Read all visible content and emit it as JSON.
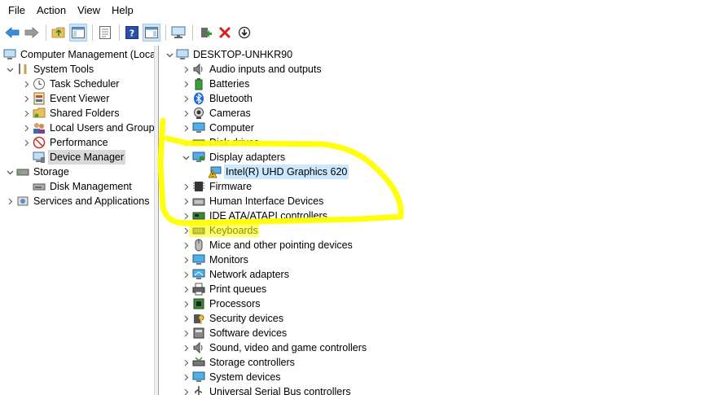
{
  "menu": [
    "File",
    "Action",
    "View",
    "Help"
  ],
  "left_tree": {
    "root": "Computer Management (Local",
    "system_tools": "System Tools",
    "task_scheduler": "Task Scheduler",
    "event_viewer": "Event Viewer",
    "shared_folders": "Shared Folders",
    "local_users": "Local Users and Groups",
    "performance": "Performance",
    "device_manager": "Device Manager",
    "storage": "Storage",
    "disk_management": "Disk Management",
    "services": "Services and Applications"
  },
  "device_tree": {
    "root": "DESKTOP-UNHKR90",
    "display_child": "Intel(R) UHD Graphics 620",
    "categories": [
      "Audio inputs and outputs",
      "Batteries",
      "Bluetooth",
      "Cameras",
      "Computer",
      "Disk drives",
      "Display adapters",
      "Firmware",
      "Human Interface Devices",
      "IDE ATA/ATAPI controllers",
      "Keyboards",
      "Mice and other pointing devices",
      "Monitors",
      "Network adapters",
      "Print queues",
      "Processors",
      "Security devices",
      "Software devices",
      "Sound, video and game controllers",
      "Storage controllers",
      "System devices",
      "Universal Serial Bus controllers"
    ]
  },
  "colors": {
    "annotation": "#ffff00",
    "selected_bg": "#d9d9d9",
    "highlight_bg": "#cce8ff"
  }
}
